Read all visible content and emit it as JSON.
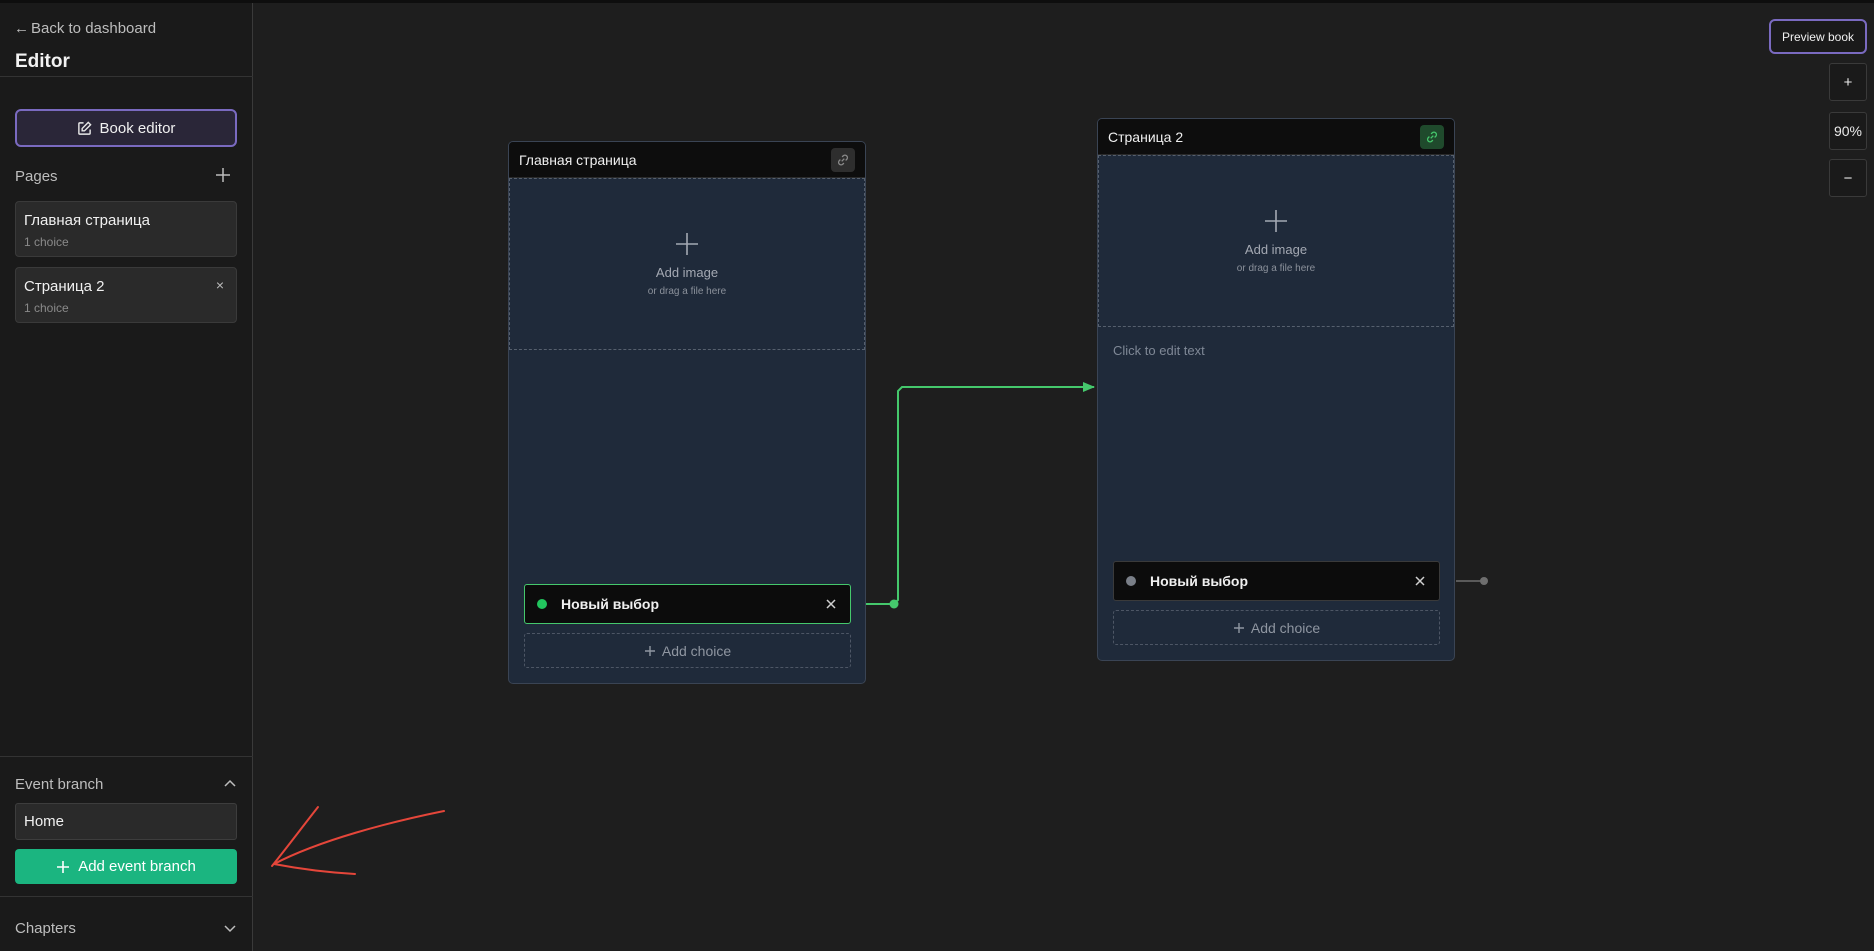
{
  "sidebar": {
    "back_label": "Back to dashboard",
    "title": "Editor",
    "book_editor_label": "Book editor",
    "pages_label": "Pages",
    "pages": [
      {
        "name": "Главная страница",
        "count": "1 choice"
      },
      {
        "name": "Страница 2",
        "count": "1 choice"
      }
    ],
    "event_branch_label": "Event branch",
    "event_branch_value": "Home",
    "add_event_branch_label": "Add event branch",
    "chapters_label": "Chapters"
  },
  "canvas": {
    "nodes": [
      {
        "title": "Главная страница",
        "add_image": "Add image",
        "drag_hint": "or drag a file here",
        "choice_label": "Новый выбор",
        "add_choice": "Add choice"
      },
      {
        "title": "Страница 2",
        "add_image": "Add image",
        "drag_hint": "or drag a file here",
        "text_placeholder": "Click to edit text",
        "choice_label": "Новый выбор",
        "add_choice": "Add choice"
      }
    ]
  },
  "controls": {
    "preview_label": "Preview book",
    "zoom_in": "+",
    "zoom_level": "90%",
    "zoom_out": "−"
  },
  "colors": {
    "accent_purple": "#7a6ac0",
    "accent_green": "#1bb580",
    "connector_green": "#45c86c",
    "annotation_red": "#e5463a"
  }
}
